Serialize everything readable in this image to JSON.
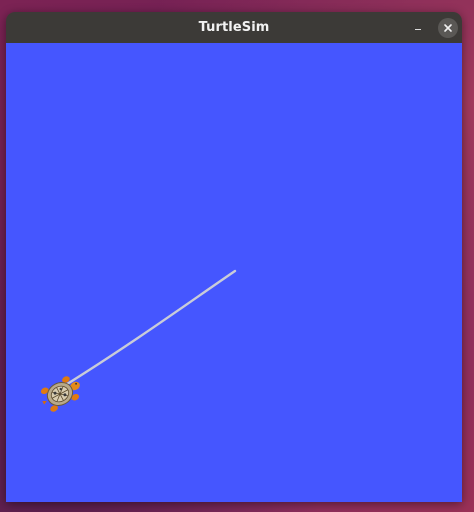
{
  "window": {
    "title": "TurtleSim",
    "minimize_icon": "minimize-icon",
    "close_icon": "close-icon"
  },
  "simulation": {
    "background_color": "#4556ff",
    "trail_color": "#c9ccd8",
    "turtle_icon": "turtle-icon"
  },
  "colors": {
    "titlebar": "#3c3a37",
    "close_button": "#5a5855",
    "desktop": "#7c2354"
  }
}
